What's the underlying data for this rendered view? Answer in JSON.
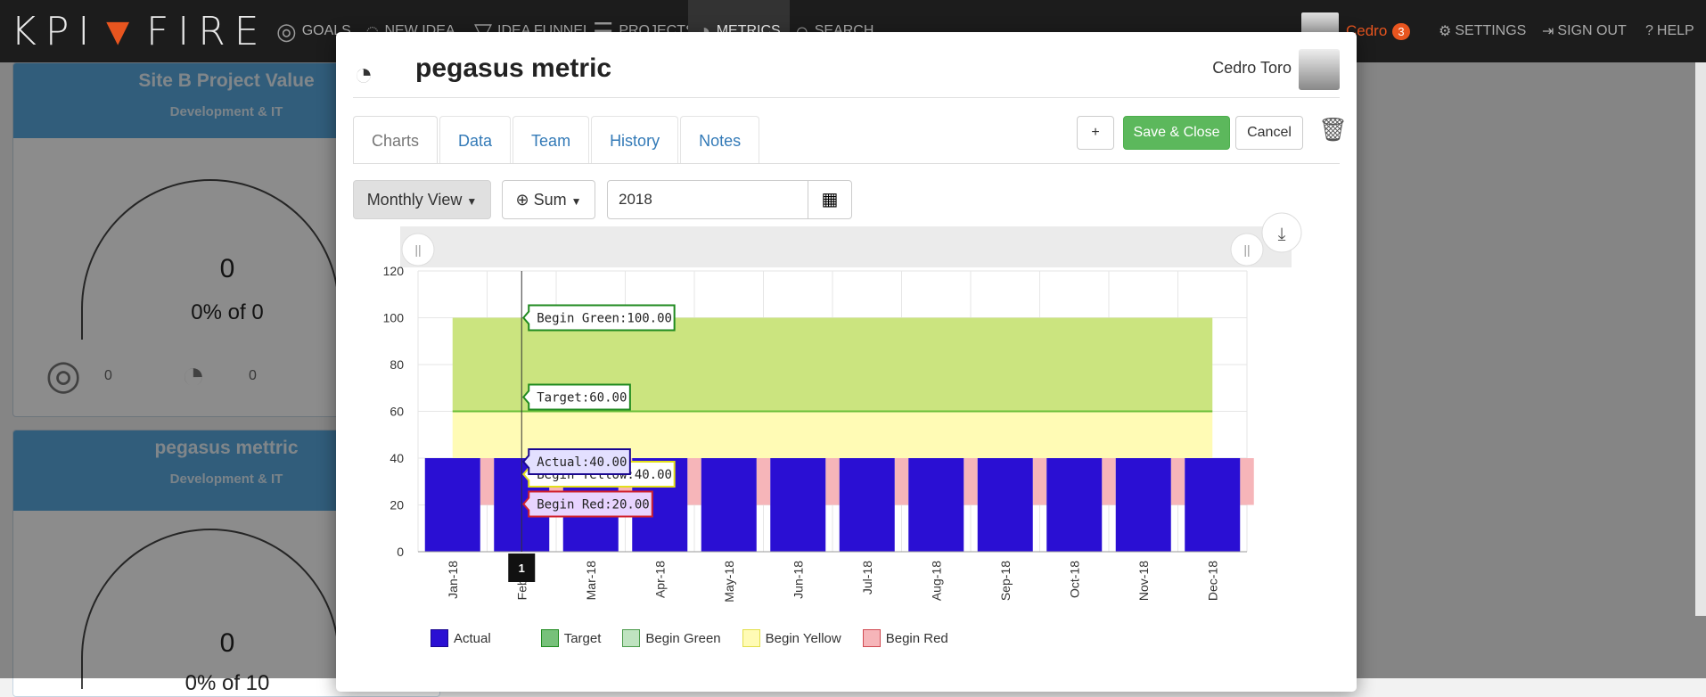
{
  "app": {
    "logo": {
      "left": "KPI",
      "mark": "▼",
      "right": "FIRE"
    },
    "nav": [
      {
        "label": "GOALS",
        "icon": "compass-icon"
      },
      {
        "label": "NEW IDEA",
        "icon": "lightbulb-icon"
      },
      {
        "label": "IDEA FUNNEL",
        "icon": "funnel-icon"
      },
      {
        "label": "PROJECTS",
        "icon": "projects-icon"
      },
      {
        "label": "METRICS",
        "icon": "dashboard-icon"
      },
      {
        "label": "SEARCH",
        "icon": "search-icon"
      }
    ],
    "user": {
      "name": "Cedro",
      "badge": "3"
    },
    "settings": "SETTINGS",
    "signout": "SIGN OUT",
    "help": "HELP"
  },
  "cards": [
    {
      "title": "Site B Project Value",
      "subtitle": "Development & IT",
      "value": "0",
      "pct": "0% of 0",
      "mini1": "0",
      "mini2": "0"
    },
    {
      "title": "pegasus mettric",
      "subtitle": "Development & IT",
      "value": "0",
      "pct": "0% of 10"
    }
  ],
  "modal": {
    "title": "pegasus metric",
    "owner": "Cedro Toro",
    "tabs": [
      "Charts",
      "Data",
      "Team",
      "History",
      "Notes"
    ],
    "buttons": {
      "add": "+",
      "save": "Save & Close",
      "cancel": "Cancel"
    },
    "controls": {
      "view": "Monthly View",
      "agg": "Sum",
      "year": "2018"
    }
  },
  "chart_data": {
    "type": "bar",
    "categories": [
      "Jan-18",
      "Feb-18",
      "Mar-18",
      "Apr-18",
      "May-18",
      "Jun-18",
      "Jul-18",
      "Aug-18",
      "Sep-18",
      "Oct-18",
      "Nov-18",
      "Dec-18"
    ],
    "series": [
      {
        "name": "Actual",
        "values": [
          40,
          40,
          40,
          40,
          40,
          40,
          40,
          40,
          40,
          40,
          40,
          40
        ]
      },
      {
        "name": "Target",
        "values": [
          60,
          60,
          60,
          60,
          60,
          60,
          60,
          60,
          60,
          60,
          60,
          60
        ]
      },
      {
        "name": "Begin Green",
        "values": [
          100,
          100,
          100,
          100,
          100,
          100,
          100,
          100,
          100,
          100,
          100,
          100
        ]
      },
      {
        "name": "Begin Yellow",
        "values": [
          40,
          40,
          40,
          40,
          40,
          40,
          40,
          40,
          40,
          40,
          40,
          40
        ]
      },
      {
        "name": "Begin Red",
        "values": [
          20,
          20,
          20,
          20,
          20,
          20,
          20,
          20,
          20,
          20,
          20,
          20
        ]
      }
    ],
    "ylim": [
      0,
      120
    ],
    "yticks": [
      0,
      20,
      40,
      60,
      80,
      100,
      120
    ],
    "tooltip": {
      "category": "Feb-18",
      "label": "1",
      "items": [
        "Begin Green:100.00",
        "Target:60.00",
        "Begin Yellow:40.00",
        "Actual:40.00",
        "Begin Red:20.00"
      ]
    },
    "colors": {
      "actual": "#2a0fd3",
      "target": "#1f8a1f",
      "green_band": "#cbe47f",
      "yellow_band": "#fffbb5",
      "red": "#f6b5b9",
      "target_line": "#6bbf3a"
    }
  }
}
